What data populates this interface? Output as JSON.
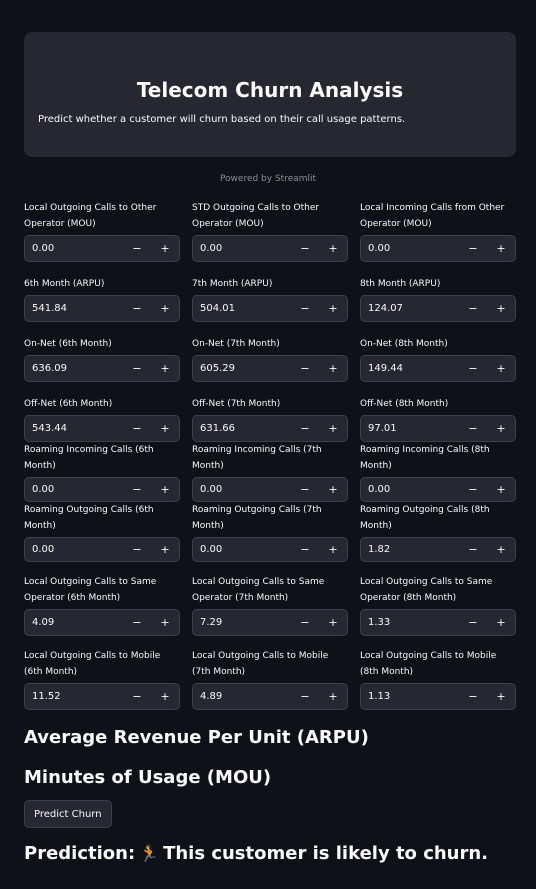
{
  "header": {
    "title": "Telecom Churn Analysis",
    "subtitle": "Predict whether a customer will churn based on their call usage patterns."
  },
  "powered_by": "Powered by Streamlit",
  "fields": [
    {
      "label": "Local Outgoing Calls to Other Operator (MOU)",
      "value": "0.00"
    },
    {
      "label": "STD Outgoing Calls to Other Operator (MOU)",
      "value": "0.00"
    },
    {
      "label": "Local Incoming Calls from Other Operator (MOU)",
      "value": "0.00"
    },
    {
      "label": "6th Month (ARPU)",
      "value": "541.84"
    },
    {
      "label": "7th Month (ARPU)",
      "value": "504.01"
    },
    {
      "label": "8th Month (ARPU)",
      "value": "124.07"
    },
    {
      "label": "On-Net (6th Month)",
      "value": "636.09"
    },
    {
      "label": "On-Net (7th Month)",
      "value": "605.29"
    },
    {
      "label": "On-Net (8th Month)",
      "value": "149.44"
    },
    {
      "label": "Off-Net (6th Month)",
      "value": "543.44"
    },
    {
      "label": "Off-Net (7th Month)",
      "value": "631.66"
    },
    {
      "label": "Off-Net (8th Month)",
      "value": "97.01"
    },
    {
      "label": "Roaming Incoming Calls (6th Month)",
      "value": "0.00"
    },
    {
      "label": "Roaming Incoming Calls (7th Month)",
      "value": "0.00"
    },
    {
      "label": "Roaming Incoming Calls (8th Month)",
      "value": "0.00"
    },
    {
      "label": "Roaming Outgoing Calls (6th Month)",
      "value": "0.00"
    },
    {
      "label": "Roaming Outgoing Calls (7th Month)",
      "value": "0.00"
    },
    {
      "label": "Roaming Outgoing Calls (8th Month)",
      "value": "1.82"
    },
    {
      "label": "Local Outgoing Calls to Same Operator (6th Month)",
      "value": "4.09"
    },
    {
      "label": "Local Outgoing Calls to Same Operator (7th Month)",
      "value": "7.29"
    },
    {
      "label": "Local Outgoing Calls to Same Operator (8th Month)",
      "value": "1.33"
    },
    {
      "label": "Local Outgoing Calls to Mobile (6th Month)",
      "value": "11.52"
    },
    {
      "label": "Local Outgoing Calls to Mobile (7th Month)",
      "value": "4.89"
    },
    {
      "label": "Local Outgoing Calls to Mobile (8th Month)",
      "value": "1.13"
    }
  ],
  "stepper": {
    "minus": "−",
    "plus": "+"
  },
  "sections": {
    "arpu": "Average Revenue Per Unit (ARPU)",
    "mou": "Minutes of Usage (MOU)"
  },
  "predict_button": "Predict Churn",
  "prediction": {
    "label": "Prediction:",
    "icon": "running-person-icon",
    "icon_glyph": "🏃",
    "text": "This customer is likely to churn."
  }
}
